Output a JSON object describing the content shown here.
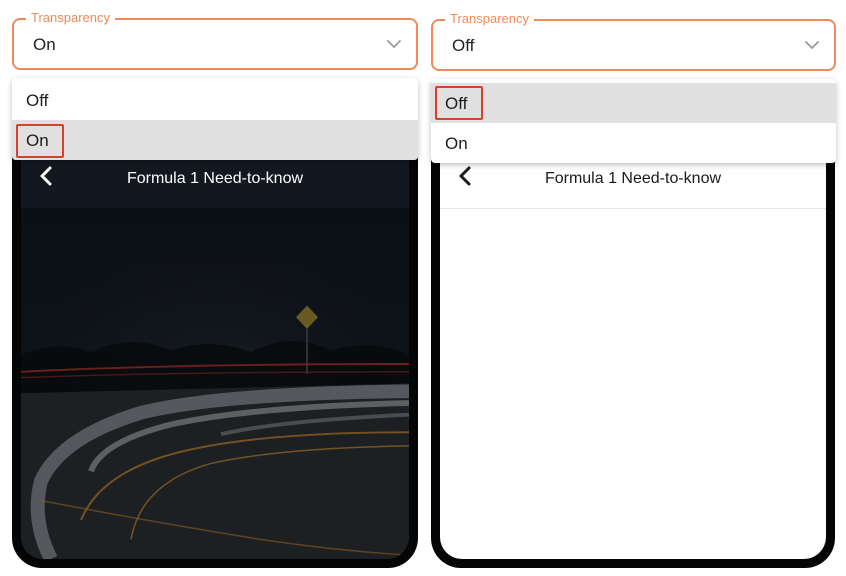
{
  "panels": {
    "left": {
      "select": {
        "label": "Transparency",
        "value": "On"
      },
      "menu": {
        "options": [
          "Off",
          "On"
        ],
        "selected": "On"
      },
      "phone": {
        "title": "Formula 1 Need-to-know",
        "transparency": "on"
      }
    },
    "right": {
      "select": {
        "label": "Transparency",
        "value": "Off"
      },
      "menu": {
        "options": [
          "Off",
          "On"
        ],
        "selected": "Off"
      },
      "phone": {
        "title": "Formula 1 Need-to-know",
        "transparency": "off"
      }
    }
  },
  "colors": {
    "accent": "#ef8a5a",
    "highlight_box": "#d8402a",
    "selected_option_bg": "#e0e0e0",
    "phone_frame": "#050505"
  },
  "icons": {
    "back": "chevron-left-icon",
    "dropdown": "chevron-down-icon"
  }
}
